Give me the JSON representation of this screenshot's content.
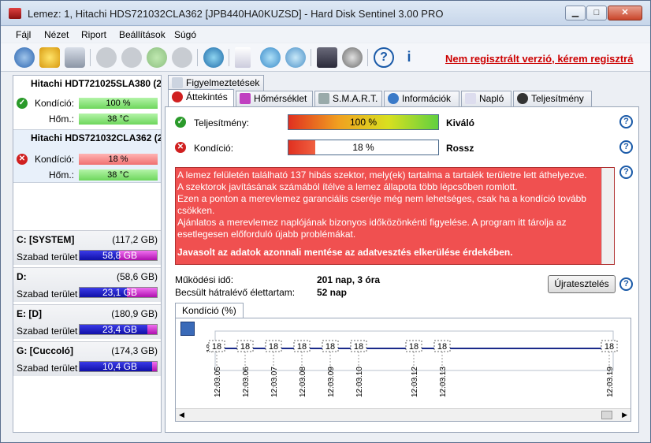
{
  "window": {
    "title": "Lemez: 1, Hitachi HDS721032CLA362 [JPB440HA0KUZSD]  -  Hard Disk Sentinel 3.00 PRO"
  },
  "menu": [
    "Fájl",
    "Nézet",
    "Riport",
    "Beállítások",
    "Súgó"
  ],
  "toolbar": {
    "registration_text": "Nem regisztrált verzió, kérem regisztrá"
  },
  "disks": [
    {
      "name": "Hitachi HDT721025SLA380",
      "suffix": "(2",
      "health_label": "Kondíció:",
      "health": "100 %",
      "health_fraction": 1.0,
      "health_status": "ok",
      "temp_label": "Hőm.:",
      "temp": "38 °C"
    },
    {
      "name": "Hitachi HDS721032CLA362",
      "suffix": "(2",
      "health_label": "Kondíció:",
      "health": "18 %",
      "health_fraction": 0.18,
      "health_status": "bad",
      "temp_label": "Hőm.:",
      "temp": "38 °C"
    }
  ],
  "volumes": [
    {
      "name": "C: [SYSTEM]",
      "size": "(117,2 GB)",
      "free_label": "Szabad terület",
      "free": "58,8 GB"
    },
    {
      "name": "D:",
      "size": "(58,6 GB)",
      "free_label": "Szabad terület",
      "free": "23,1 GB"
    },
    {
      "name": "E: [D]",
      "size": "(180,9 GB)",
      "free_label": "Szabad terület",
      "free": "23,4 GB"
    },
    {
      "name": "G: [Cuccoló]",
      "size": "(174,3 GB)",
      "free_label": "Szabad terület",
      "free": "10,4 GB"
    }
  ],
  "tabs_top": [
    "Figyelmeztetések"
  ],
  "tabs": [
    "Áttekintés",
    "Hőmérséklet",
    "S.M.A.R.T.",
    "Információk",
    "Napló",
    "Teljesítmény"
  ],
  "overview": {
    "performance_label": "Teljesítmény:",
    "performance_value": "100 %",
    "performance_fraction": 1.0,
    "performance_word": "Kiváló",
    "health_label": "Kondíció:",
    "health_value": "18 %",
    "health_fraction": 0.18,
    "health_word": "Rossz",
    "message_lines": [
      "A lemez felületén található 137 hibás szektor, mely(ek) tartalma a tartalék területre lett áthelyezve.",
      "A szektorok javításának számából ítélve a lemez állapota több lépcsőben romlott.",
      "Ezen a ponton a merevlemez garanciális cseréje még nem lehetséges, csak ha a kondíció tovább csökken.",
      "Ajánlatos a merevlemez naplójának bizonyos időközönkénti figyelése. A program itt tárolja az esetlegesen előforduló újabb problémákat."
    ],
    "message_bold": "Javasolt az adatok azonnali mentése az adatvesztés elkerülése érdekében.",
    "uptime_label": "Működési idő:",
    "uptime_value": "201 nap, 3 óra",
    "remaining_label": "Becsült hátralévő élettartam:",
    "remaining_value": "52 nap",
    "retest_button": "Újratesztelés",
    "chart_tab": "Kondíció  (%)"
  },
  "chart_data": {
    "type": "line",
    "x": [
      "12.03.05",
      "12.03.06",
      "12.03.07",
      "12.03.08",
      "12.03.09",
      "12.03.10",
      "12.03.12",
      "12.03.13",
      "12.03.19"
    ],
    "values": [
      18,
      18,
      18,
      18,
      18,
      18,
      18,
      18,
      18
    ],
    "data_labels": [
      "18",
      "18",
      "18",
      "18",
      "18",
      "18",
      "18",
      "18",
      "18"
    ],
    "ytick": "18",
    "title": "Kondíció  (%)"
  }
}
